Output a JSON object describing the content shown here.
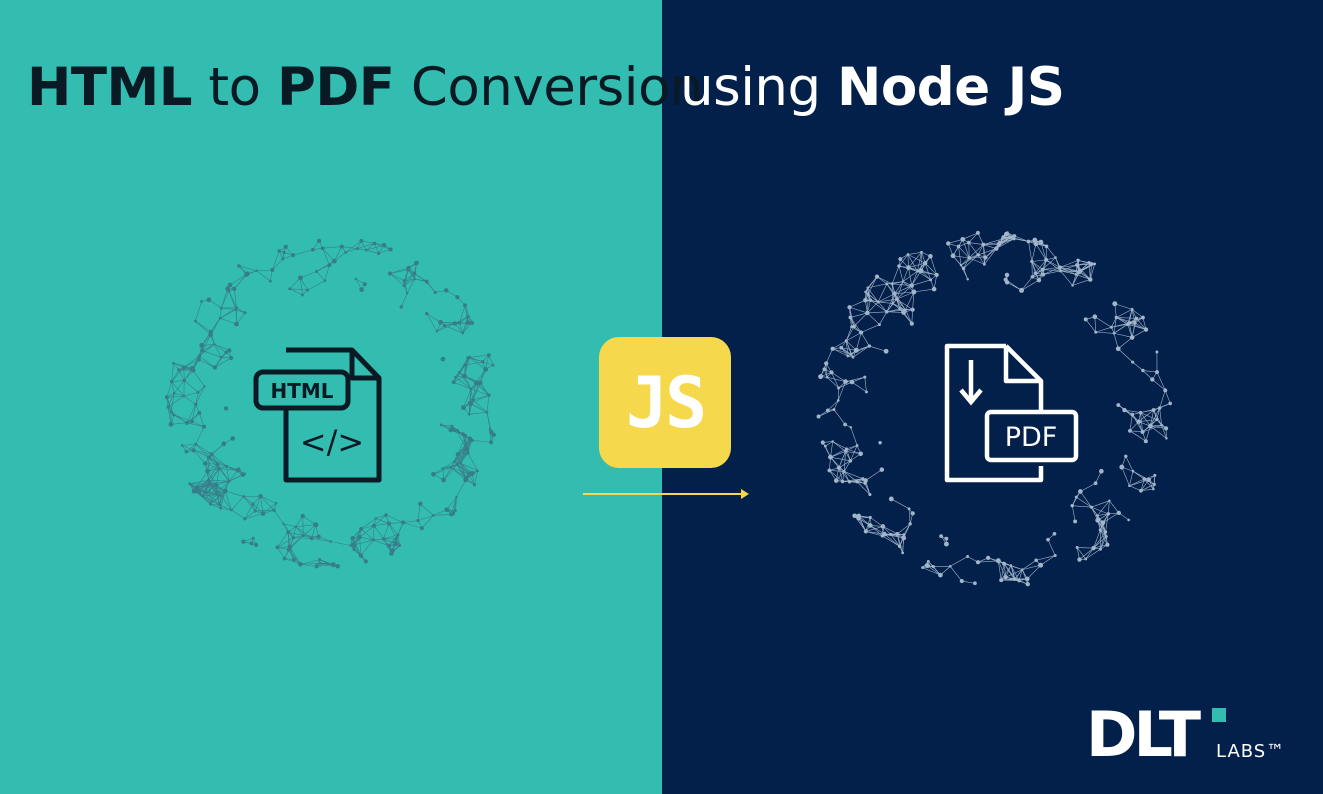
{
  "headline": {
    "left_bold_1": "HTML",
    "left_light_1": "to",
    "left_bold_2": "PDF",
    "left_light_2": "Conversion",
    "right_light": "using",
    "right_bold": "Node JS"
  },
  "html_icon": {
    "label": "HTML",
    "code_symbol": "</>"
  },
  "js_badge": {
    "label": "JS"
  },
  "pdf_icon": {
    "label": "PDF"
  },
  "logo": {
    "main": "DLT",
    "sub": "LABS™"
  },
  "colors": {
    "left_panel": "#33bdb0",
    "right_panel": "#03204b",
    "js_badge": "#f5d84c",
    "arrow": "#f5d84c",
    "dark_text": "#0a1a24",
    "light_text": "#ffffff"
  },
  "icons": [
    "html-file-icon",
    "code-brackets-icon",
    "js-icon",
    "arrow-right-icon",
    "pdf-file-icon",
    "download-arrow-icon",
    "network-sphere-icon"
  ]
}
